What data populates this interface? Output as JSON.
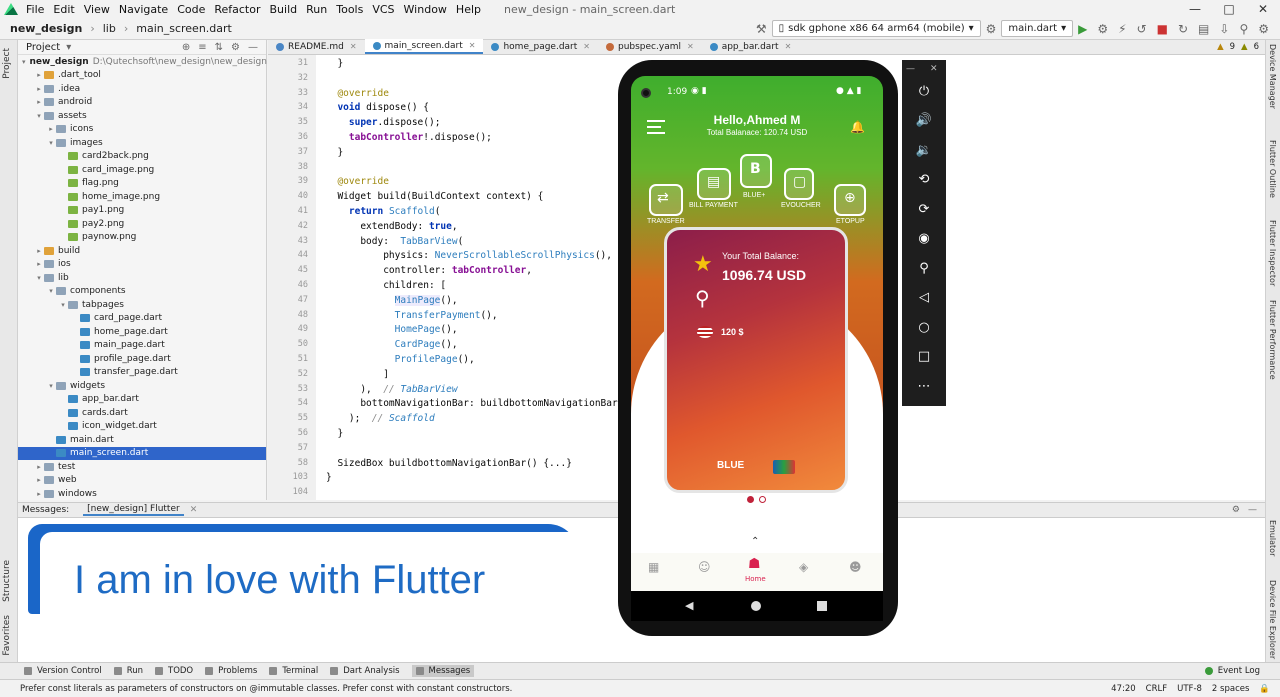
{
  "menubar": {
    "items": [
      "File",
      "Edit",
      "View",
      "Navigate",
      "Code",
      "Refactor",
      "Build",
      "Run",
      "Tools",
      "VCS",
      "Window",
      "Help"
    ],
    "window_title": "new_design - main_screen.dart"
  },
  "navbar": {
    "crumbs": [
      "new_design",
      "lib",
      "main_screen.dart"
    ],
    "device": "sdk gphone x86 64 arm64 (mobile)",
    "run_config": "main.dart"
  },
  "project": {
    "title": "Project",
    "tree": [
      {
        "label": "new_design",
        "path": "D:\\Qutechsoft\\new_design\\new_design",
        "indent": 0,
        "icon": "folder",
        "open": true,
        "bold": true
      },
      {
        "label": ".dart_tool",
        "indent": 1,
        "icon": "folder-excluded",
        "open": false
      },
      {
        "label": ".idea",
        "indent": 1,
        "icon": "folder",
        "open": false
      },
      {
        "label": "android",
        "indent": 1,
        "icon": "folder",
        "open": false
      },
      {
        "label": "assets",
        "indent": 1,
        "icon": "folder",
        "open": true
      },
      {
        "label": "icons",
        "indent": 2,
        "icon": "folder",
        "open": false
      },
      {
        "label": "images",
        "indent": 2,
        "icon": "folder",
        "open": true
      },
      {
        "label": "card2back.png",
        "indent": 3,
        "icon": "png"
      },
      {
        "label": "card_image.png",
        "indent": 3,
        "icon": "png"
      },
      {
        "label": "flag.png",
        "indent": 3,
        "icon": "png"
      },
      {
        "label": "home_image.png",
        "indent": 3,
        "icon": "png"
      },
      {
        "label": "pay1.png",
        "indent": 3,
        "icon": "png"
      },
      {
        "label": "pay2.png",
        "indent": 3,
        "icon": "png"
      },
      {
        "label": "paynow.png",
        "indent": 3,
        "icon": "png"
      },
      {
        "label": "build",
        "indent": 1,
        "icon": "folder-excluded",
        "open": false
      },
      {
        "label": "ios",
        "indent": 1,
        "icon": "folder",
        "open": false
      },
      {
        "label": "lib",
        "indent": 1,
        "icon": "folder",
        "open": true
      },
      {
        "label": "components",
        "indent": 2,
        "icon": "folder",
        "open": true
      },
      {
        "label": "tabpages",
        "indent": 3,
        "icon": "folder",
        "open": true
      },
      {
        "label": "card_page.dart",
        "indent": 4,
        "icon": "dart"
      },
      {
        "label": "home_page.dart",
        "indent": 4,
        "icon": "dart"
      },
      {
        "label": "main_page.dart",
        "indent": 4,
        "icon": "dart"
      },
      {
        "label": "profile_page.dart",
        "indent": 4,
        "icon": "dart"
      },
      {
        "label": "transfer_page.dart",
        "indent": 4,
        "icon": "dart"
      },
      {
        "label": "widgets",
        "indent": 2,
        "icon": "folder",
        "open": true
      },
      {
        "label": "app_bar.dart",
        "indent": 3,
        "icon": "dart"
      },
      {
        "label": "cards.dart",
        "indent": 3,
        "icon": "dart"
      },
      {
        "label": "icon_widget.dart",
        "indent": 3,
        "icon": "dart"
      },
      {
        "label": "main.dart",
        "indent": 2,
        "icon": "dart"
      },
      {
        "label": "main_screen.dart",
        "indent": 2,
        "icon": "dart",
        "selected": true
      },
      {
        "label": "test",
        "indent": 1,
        "icon": "folder",
        "open": false
      },
      {
        "label": "web",
        "indent": 1,
        "icon": "folder",
        "open": false
      },
      {
        "label": "windows",
        "indent": 1,
        "icon": "folder",
        "open": false
      }
    ]
  },
  "tabs": [
    "README.md",
    "main_screen.dart",
    "home_page.dart",
    "pubspec.yaml",
    "app_bar.dart"
  ],
  "editor": {
    "warnings": "9",
    "weak_warnings": "6",
    "lines": [
      {
        "n": "31",
        "t": "  }"
      },
      {
        "n": "32",
        "t": ""
      },
      {
        "n": "33",
        "t": "  @override"
      },
      {
        "n": "34",
        "t": "  void dispose() {"
      },
      {
        "n": "35",
        "t": "    super.dispose();"
      },
      {
        "n": "36",
        "t": "    tabController!.dispose();"
      },
      {
        "n": "37",
        "t": "  }"
      },
      {
        "n": "38",
        "t": ""
      },
      {
        "n": "39",
        "t": "  @override"
      },
      {
        "n": "40",
        "t": "  Widget build(BuildContext context) {"
      },
      {
        "n": "41",
        "t": "    return Scaffold("
      },
      {
        "n": "42",
        "t": "      extendBody: true,"
      },
      {
        "n": "43",
        "t": "      body:  TabBarView("
      },
      {
        "n": "44",
        "t": "          physics: NeverScrollableScrollPhysics(),"
      },
      {
        "n": "45",
        "t": "          controller: tabController,"
      },
      {
        "n": "46",
        "t": "          children: ["
      },
      {
        "n": "47",
        "t": "            MainPage(),"
      },
      {
        "n": "48",
        "t": "            TransferPayment(),"
      },
      {
        "n": "49",
        "t": "            HomePage(),"
      },
      {
        "n": "50",
        "t": "            CardPage(),"
      },
      {
        "n": "51",
        "t": "            ProfilePage(),"
      },
      {
        "n": "52",
        "t": "          ]"
      },
      {
        "n": "53",
        "t": "      ),  // TabBarView"
      },
      {
        "n": "54",
        "t": "      bottomNavigationBar: buildbottomNavigationBar(),"
      },
      {
        "n": "55",
        "t": "    );  // Scaffold"
      },
      {
        "n": "56",
        "t": "  }"
      },
      {
        "n": "57",
        "t": ""
      },
      {
        "n": "58",
        "t": "  SizedBox buildbottomNavigationBar() {...}"
      },
      {
        "n": "103",
        "t": "}"
      },
      {
        "n": "104",
        "t": ""
      }
    ]
  },
  "messages": {
    "label": "Messages:",
    "tab": "[new_design] Flutter",
    "banner": "I am in love with Flutter"
  },
  "bottom_tools": [
    "Version Control",
    "Run",
    "TODO",
    "Problems",
    "Terminal",
    "Dart Analysis",
    "Messages"
  ],
  "event_log": "Event Log",
  "status": {
    "message": "Prefer const literals as parameters of constructors on @immutable classes. Prefer const with constant constructors.",
    "position": "47:20",
    "line_sep": "CRLF",
    "encoding": "UTF-8",
    "indent": "2 spaces"
  },
  "side_tabs_left": [
    "Project",
    "Structure",
    "Favorites"
  ],
  "side_tabs_right": [
    "Device Manager",
    "Flutter Outline",
    "Flutter Inspector",
    "Flutter Performance",
    "Emulator",
    "Device File Explorer"
  ],
  "phone": {
    "time": "1:09",
    "greeting": "Hello,Ahmed M",
    "total": "Total Balanace: 120.74 USD",
    "actions": [
      "TRANSFER",
      "BILL PAYMENT",
      "BLUE+",
      "EVOUCHER",
      "ETOPUP"
    ],
    "card_label": "Your Total Balance:",
    "card_amount": "1096.74 USD",
    "card_usd": "120 $",
    "card_brand": "BLUE",
    "nav_home": "Home"
  },
  "colors": {
    "accent": "#2f65ca",
    "banner": "#1e6bc4",
    "phone_green": "#3fae2d",
    "card_red": "#b5333d"
  }
}
